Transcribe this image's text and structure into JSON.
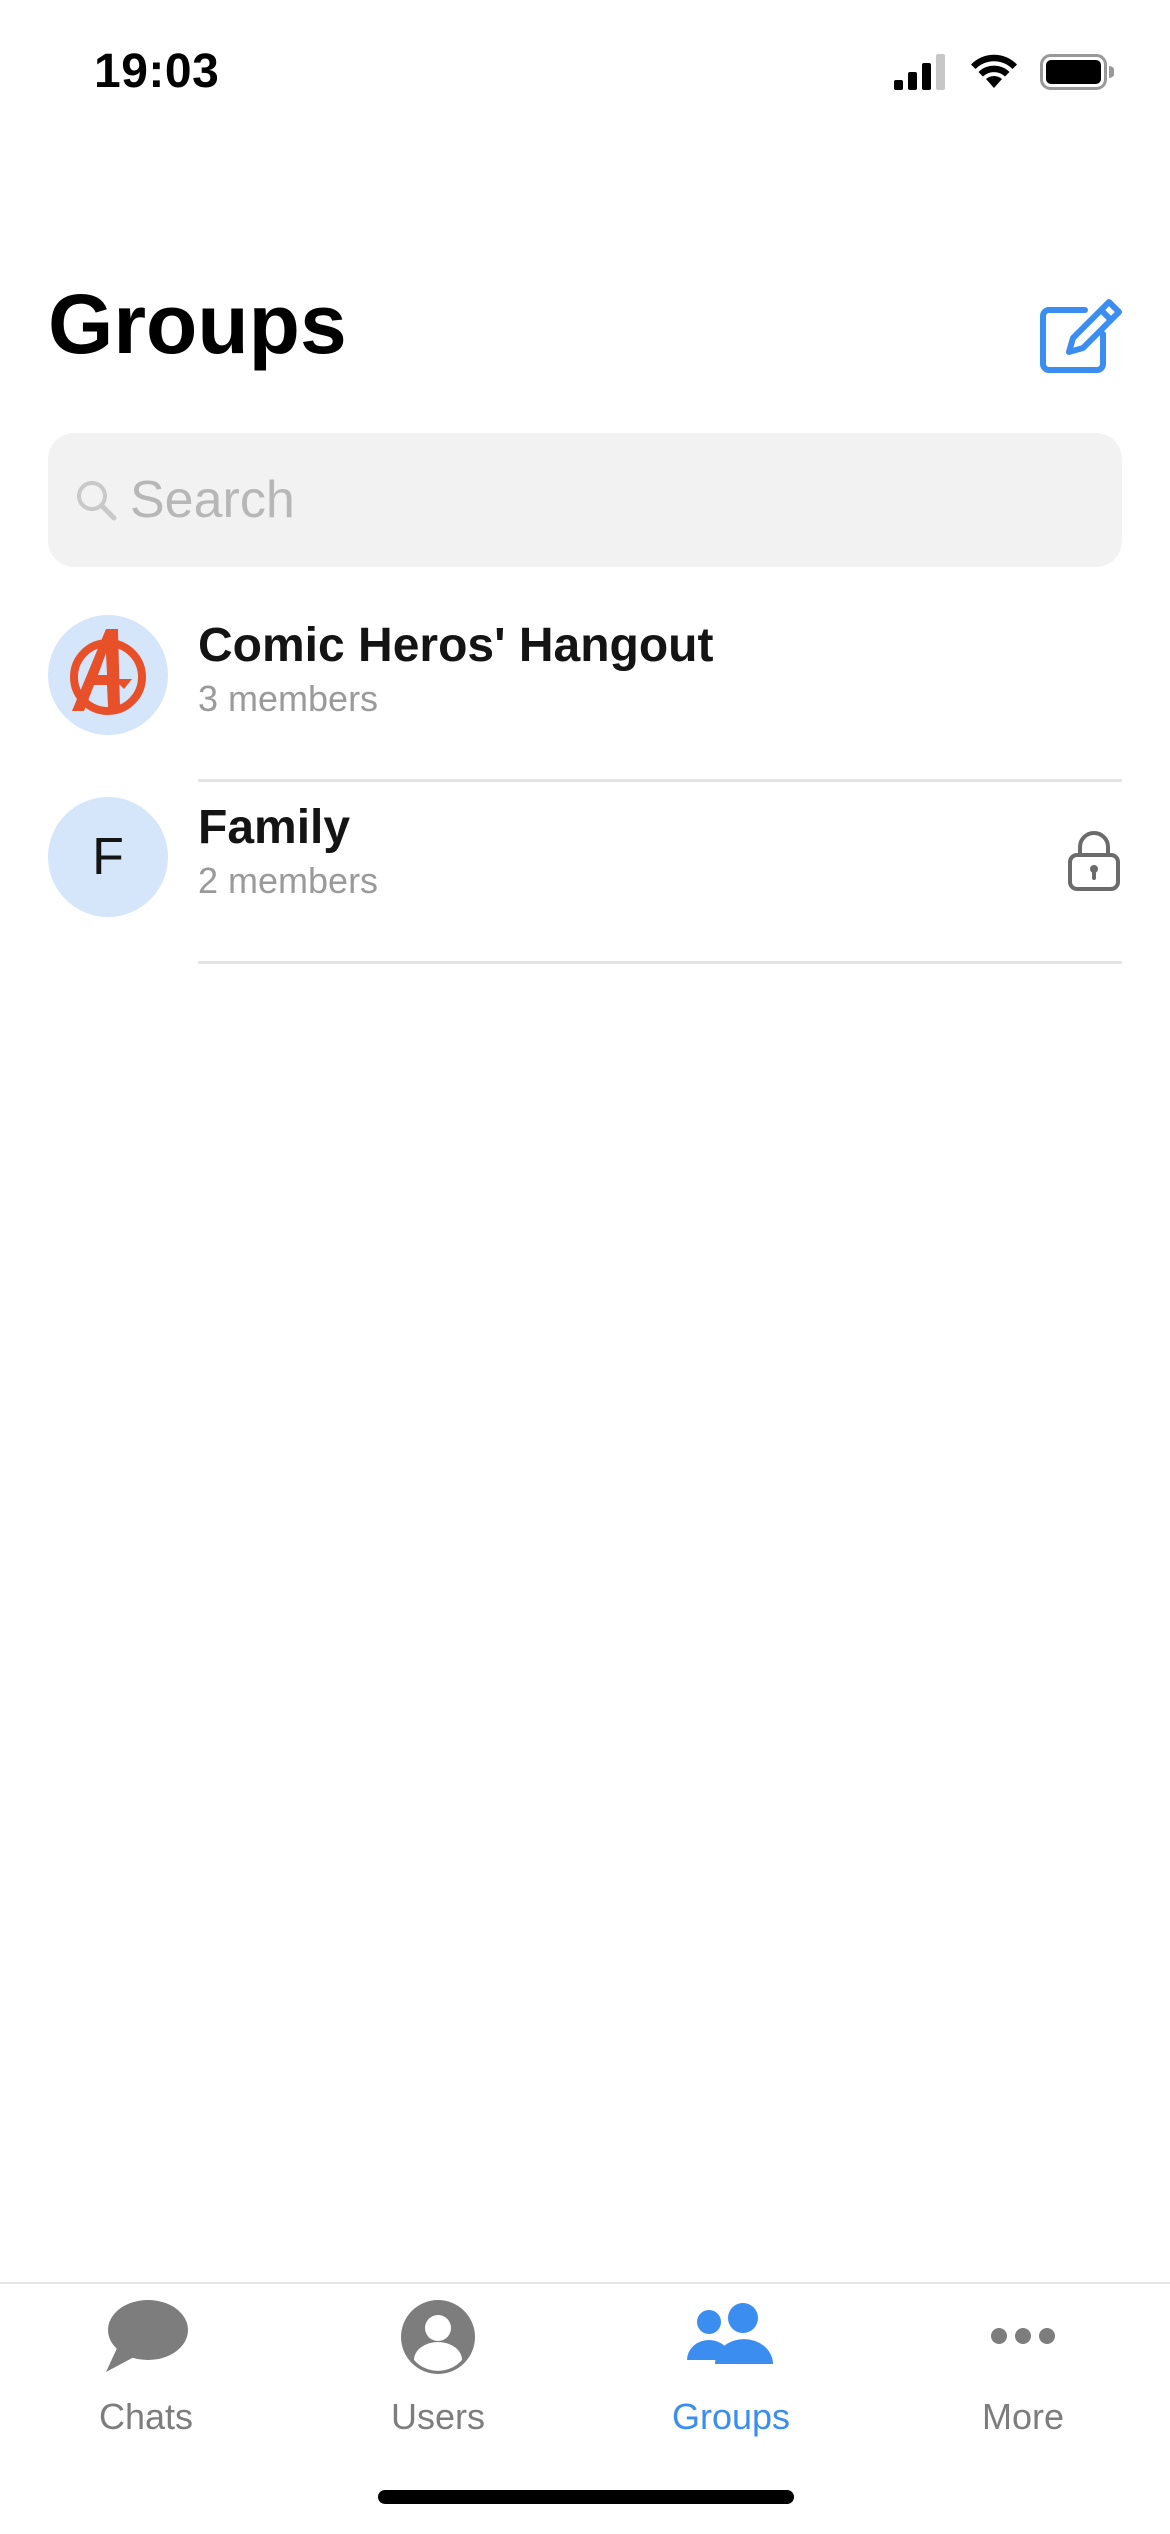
{
  "status_bar": {
    "time": "19:03",
    "icons": [
      "cellular-signal-icon",
      "wifi-icon",
      "battery-icon"
    ]
  },
  "header": {
    "title": "Groups",
    "compose_icon": "compose-icon"
  },
  "search": {
    "placeholder": "Search",
    "value": ""
  },
  "groups": [
    {
      "name": "Comic Heros' Hangout",
      "members": "3 members",
      "avatar": "avengers-logo",
      "locked": false
    },
    {
      "name": "Family",
      "members": "2 members",
      "avatar_letter": "F",
      "locked": true
    }
  ],
  "tab_bar": {
    "tabs": [
      {
        "label": "Chats",
        "icon": "chat-bubble-icon",
        "active": false
      },
      {
        "label": "Users",
        "icon": "user-icon",
        "active": false
      },
      {
        "label": "Groups",
        "icon": "groups-icon",
        "active": true
      },
      {
        "label": "More",
        "icon": "more-icon",
        "active": false
      }
    ]
  },
  "colors": {
    "accent": "#3b8ef0",
    "avatar_background": "#d5e6fb",
    "avatar_logo": "#e8502a",
    "tab_inactive": "#7d7d7d"
  }
}
